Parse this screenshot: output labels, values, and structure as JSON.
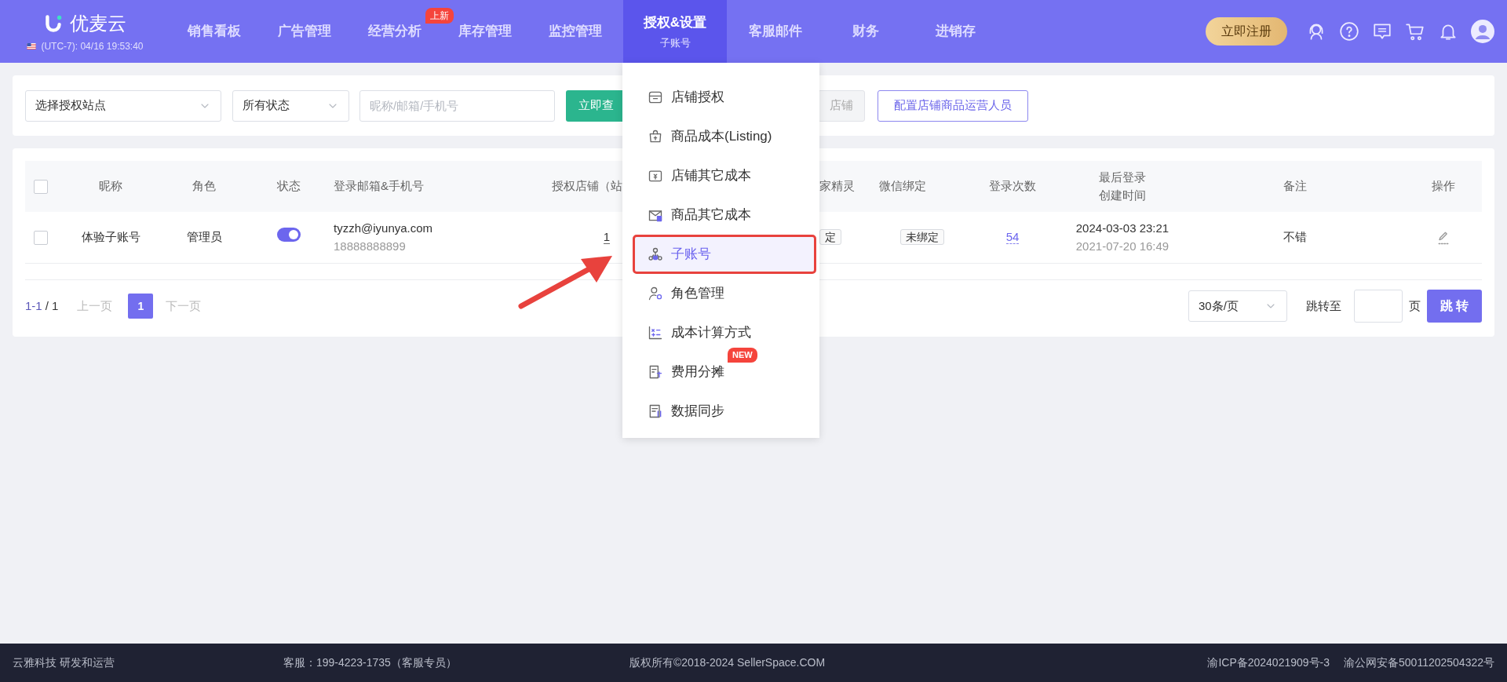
{
  "topbar": {
    "logo": "优麦云",
    "clock": "(UTC-7): 04/16 19:53:40",
    "nav": [
      {
        "label": "销售看板",
        "selected": false
      },
      {
        "label": "广告管理",
        "selected": false
      },
      {
        "label": "经营分析",
        "selected": false,
        "badge": "上新"
      },
      {
        "label": "库存管理",
        "selected": false
      },
      {
        "label": "监控管理",
        "selected": false
      },
      {
        "label": "授权&设置",
        "selected": true,
        "sub": "子账号"
      },
      {
        "label": "客服邮件",
        "selected": false
      },
      {
        "label": "财务",
        "selected": false
      },
      {
        "label": "进销存",
        "selected": false
      }
    ],
    "register_button": "立即注册"
  },
  "toolbar": {
    "site_select": "选择授权站点",
    "status_select": "所有状态",
    "search": {
      "placeholder": "昵称/邮箱/手机号"
    },
    "query_button": "立即查",
    "store_button": "店铺",
    "config_button": "配置店铺商品运营人员"
  },
  "table": {
    "header_checked": false,
    "columns": [
      {
        "label": "昵称"
      },
      {
        "label": "角色"
      },
      {
        "label": "状态"
      },
      {
        "label": "登录邮箱&手机号"
      },
      {
        "label": "授权店铺（站"
      },
      {
        "label": "家精灵"
      },
      {
        "label": "微信绑定"
      },
      {
        "label": "登录次数"
      },
      {
        "label": "最后登录",
        "sub": "创建时间"
      },
      {
        "label": "备注"
      },
      {
        "label": "操作"
      }
    ],
    "rows": [
      {
        "checked": false,
        "nickname": "体验子账号",
        "role": "管理员",
        "enabled": true,
        "email": "tyzzh@iyunya.com",
        "phone": "18888888899",
        "stores": "1",
        "column_7": "定",
        "wechat": "未绑定",
        "login_count": "54",
        "last_login": "2024-03-03 23:21",
        "created": "2021-07-20 16:49",
        "note": "不错"
      }
    ]
  },
  "pagination": {
    "range": "1-1",
    "total": "/ 1",
    "prev": "上一页",
    "pages": [
      {
        "label": "1",
        "selected": true
      }
    ],
    "next": "下一页",
    "page_size": "30条/页",
    "jump_label": "跳转至",
    "page_unit": "页",
    "jump_button": "跳 转"
  },
  "menu": {
    "items": [
      {
        "label": "店铺授权",
        "selected": false
      },
      {
        "label": "商品成本(Listing)",
        "selected": false
      },
      {
        "label": "店铺其它成本",
        "selected": false
      },
      {
        "label": "商品其它成本",
        "selected": false
      },
      {
        "label": "子账号",
        "selected": true
      },
      {
        "label": "角色管理",
        "selected": false
      },
      {
        "label": "成本计算方式",
        "selected": false
      },
      {
        "label": "费用分摊",
        "selected": false,
        "badge": "NEW"
      },
      {
        "label": "数据同步",
        "selected": false
      }
    ]
  },
  "footer": [
    "云雅科技 研发和运营",
    "客服：199-4223-1735（客服专员）",
    "版权所有©2018-2024 SellerSpace.COM",
    "渝ICP备2024021909号-3",
    "渝公网安备50011202504322号"
  ]
}
